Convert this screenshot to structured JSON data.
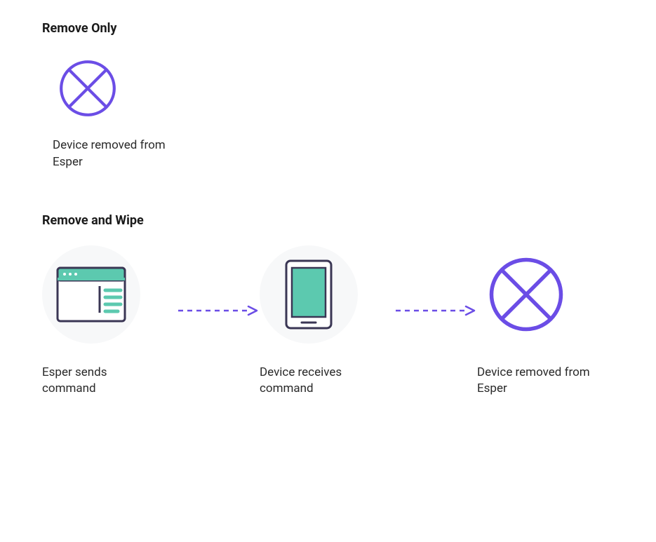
{
  "sections": {
    "remove_only": {
      "title": "Remove Only",
      "steps": [
        {
          "label": "Device removed from Esper",
          "icon": "cross-circle"
        }
      ]
    },
    "remove_and_wipe": {
      "title": "Remove and Wipe",
      "steps": [
        {
          "label": "Esper sends command",
          "icon": "browser-window"
        },
        {
          "label": "Device receives command",
          "icon": "mobile-device"
        },
        {
          "label": "Device removed from Esper",
          "icon": "cross-circle"
        }
      ]
    }
  },
  "colors": {
    "purple": "#6b4de6",
    "teal": "#4fbfa5",
    "teal_fill": "#5cc9af",
    "icon_stroke": "#3a3654",
    "circle_bg": "#f7f8f9"
  }
}
